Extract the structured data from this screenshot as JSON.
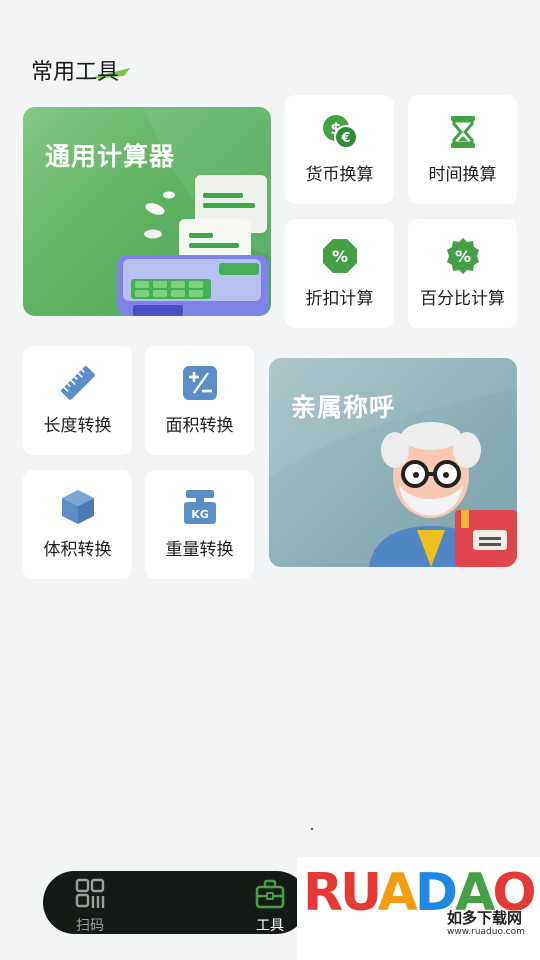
{
  "section": {
    "title": "常用工具"
  },
  "featured": [
    {
      "id": "calc",
      "label": "通用计算器"
    },
    {
      "id": "kinship",
      "label": "亲属称呼"
    }
  ],
  "tools": {
    "currency": "货币换算",
    "time": "时间换算",
    "discount": "折扣计算",
    "percent": "百分比计算",
    "length": "长度转换",
    "area": "面积转换",
    "volume": "体积转换",
    "weight": "重量转换",
    "weight_icon_text": "KG"
  },
  "tabbar": {
    "scan_label": "扫码",
    "tools_label": "工具"
  },
  "watermark": {
    "letters": [
      "R",
      "U",
      "A",
      "D",
      "A",
      "O"
    ],
    "subtitle": "如多下载网",
    "url": "www.ruaduo.com"
  },
  "colors": {
    "accent_green": "#43a047",
    "icon_blue": "#5b8ec8",
    "tabbar_bg": "#161a16",
    "page_bg": "#f3f4f6"
  }
}
